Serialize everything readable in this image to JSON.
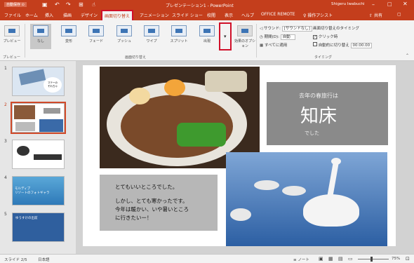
{
  "app": {
    "title": "プレゼンテーション1 - PowerPoint",
    "user": "Shigeru Iwabuchi"
  },
  "tabs": [
    "ファイル",
    "ホーム",
    "挿入",
    "描画",
    "デザイン",
    "画面切り替え",
    "アニメーション",
    "スライド ショー",
    "校閲",
    "表示",
    "ヘルプ",
    "OFFICE REMOTE"
  ],
  "active_tab": "画面切り替え",
  "tell_me": "操作アシスト",
  "share": "共有",
  "ribbon": {
    "preview": "プレビュー",
    "transitions": [
      "なし",
      "変形",
      "フェード",
      "プッシュ",
      "ワイプ",
      "スプリット",
      "出現"
    ],
    "effect_options": "効果のオプション",
    "group_transitions": "画面切り替え",
    "group_preview": "プレビュー",
    "group_timing": "タイミング",
    "sound_label": "サウンド:",
    "sound_value": "[サウンドなし]",
    "duration_label": "期間(D):",
    "duration_value": "自動",
    "apply_all": "すべてに適用",
    "advance_label": "画面切り替えのタイミング",
    "on_click": "クリック時",
    "after_label": "自動的に切り替え",
    "after_value": "00:00.00"
  },
  "slides": [
    {
      "n": "1",
      "text": "マテーの\nそれちゃ"
    },
    {
      "n": "2",
      "text": ""
    },
    {
      "n": "3",
      "text": ""
    },
    {
      "n": "4",
      "text": "モルディブ\nリゾートのフォトギャラ"
    },
    {
      "n": "5",
      "text": "ゆうすけの出前"
    }
  ],
  "slide": {
    "subtitle": "去年の春旅行は",
    "title": "知床",
    "tag": "でした",
    "body_line1": "とてもいいところでした。",
    "body_line2": "しかし、とても寒かったです。",
    "body_line3": "今年は暖かい、いや暑いところ",
    "body_line4": "に行きたいー！"
  },
  "status": {
    "slide": "スライド 2/5",
    "lang": "日本語",
    "notes": "ノート",
    "zoom": "75%"
  },
  "colors": {
    "accent": "#c43e1c",
    "highlight": "#d0102a"
  }
}
